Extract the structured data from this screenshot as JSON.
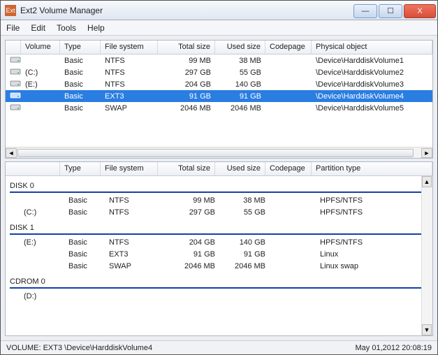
{
  "window": {
    "title": "Ext2 Volume Manager",
    "icon_text": "Ext"
  },
  "winbtns": {
    "min": "—",
    "max": "☐",
    "close": "X"
  },
  "menu": {
    "file": "File",
    "edit": "Edit",
    "tools": "Tools",
    "help": "Help"
  },
  "top_headers": {
    "volume": "Volume",
    "type": "Type",
    "fs": "File system",
    "total": "Total size",
    "used": "Used size",
    "codepage": "Codepage",
    "physical": "Physical object"
  },
  "volumes": [
    {
      "vol": "",
      "type": "Basic",
      "fs": "NTFS",
      "total": "99 MB",
      "used": "38 MB",
      "cp": "",
      "po": "\\Device\\HarddiskVolume1",
      "selected": false
    },
    {
      "vol": "(C:)",
      "type": "Basic",
      "fs": "NTFS",
      "total": "297 GB",
      "used": "55 GB",
      "cp": "",
      "po": "\\Device\\HarddiskVolume2",
      "selected": false
    },
    {
      "vol": "(E:)",
      "type": "Basic",
      "fs": "NTFS",
      "total": "204 GB",
      "used": "140 GB",
      "cp": "",
      "po": "\\Device\\HarddiskVolume3",
      "selected": false
    },
    {
      "vol": "",
      "type": "Basic",
      "fs": "EXT3",
      "total": "91 GB",
      "used": "91 GB",
      "cp": "",
      "po": "\\Device\\HarddiskVolume4",
      "selected": true
    },
    {
      "vol": "",
      "type": "Basic",
      "fs": "SWAP",
      "total": "2046 MB",
      "used": "2046 MB",
      "cp": "",
      "po": "\\Device\\HarddiskVolume5",
      "selected": false
    }
  ],
  "bottom_headers": {
    "type": "Type",
    "fs": "File system",
    "total": "Total size",
    "used": "Used size",
    "codepage": "Codepage",
    "ptype": "Partition type"
  },
  "disks": [
    {
      "name": "DISK 0",
      "parts": [
        {
          "vol": "",
          "type": "Basic",
          "fs": "NTFS",
          "total": "99 MB",
          "used": "38 MB",
          "cp": "",
          "pt": "HPFS/NTFS"
        },
        {
          "vol": "(C:)",
          "type": "Basic",
          "fs": "NTFS",
          "total": "297 GB",
          "used": "55 GB",
          "cp": "",
          "pt": "HPFS/NTFS"
        }
      ]
    },
    {
      "name": "DISK 1",
      "parts": [
        {
          "vol": "(E:)",
          "type": "Basic",
          "fs": "NTFS",
          "total": "204 GB",
          "used": "140 GB",
          "cp": "",
          "pt": "HPFS/NTFS"
        },
        {
          "vol": "",
          "type": "Basic",
          "fs": "EXT3",
          "total": "91 GB",
          "used": "91 GB",
          "cp": "",
          "pt": "Linux"
        },
        {
          "vol": "",
          "type": "Basic",
          "fs": "SWAP",
          "total": "2046 MB",
          "used": "2046 MB",
          "cp": "",
          "pt": "Linux swap"
        }
      ]
    },
    {
      "name": "CDROM 0",
      "parts": [
        {
          "vol": "(D:)",
          "type": "",
          "fs": "",
          "total": "",
          "used": "",
          "cp": "",
          "pt": ""
        }
      ]
    }
  ],
  "status": {
    "left": "VOLUME:  EXT3 \\Device\\HarddiskVolume4",
    "right": "May 01,2012 20:08:19"
  }
}
